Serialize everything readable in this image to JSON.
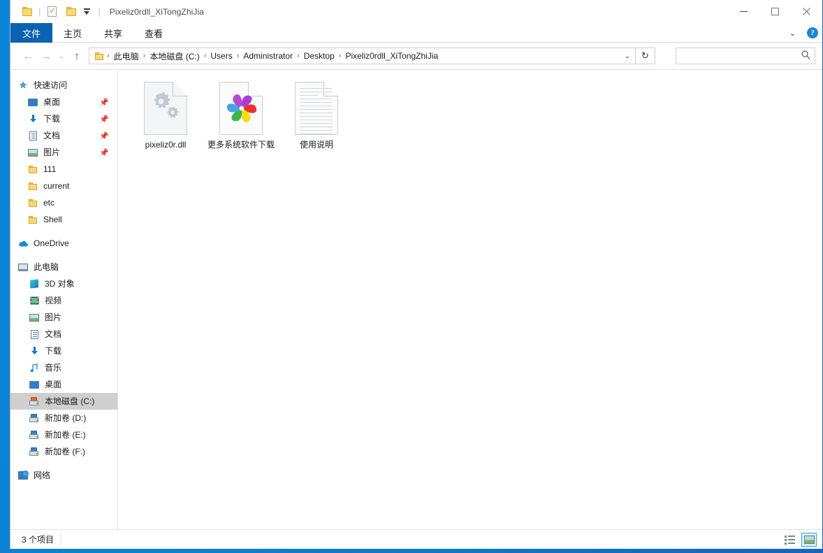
{
  "window": {
    "title": "Pixeliz0rdll_XiTongZhiJia",
    "quick_access_toolbar": [
      {
        "name": "properties-icon",
        "label": "属性"
      },
      {
        "name": "new-folder-icon",
        "label": "新建文件夹"
      },
      {
        "name": "customize-qat-icon",
        "label": "自定义快速访问工具栏"
      }
    ],
    "controls": {
      "minimize": "—",
      "maximize": "☐",
      "close": "✕"
    }
  },
  "ribbon": {
    "tabs": [
      {
        "label": "文件",
        "active": true
      },
      {
        "label": "主页",
        "active": false
      },
      {
        "label": "共享",
        "active": false
      },
      {
        "label": "查看",
        "active": false
      }
    ],
    "collapse_chevron": "⌄",
    "help_label": "?"
  },
  "navigation": {
    "back": "←",
    "forward": "→",
    "recent": "⌄",
    "up": "↑",
    "breadcrumbs": [
      "此电脑",
      "本地磁盘 (C:)",
      "Users",
      "Administrator",
      "Desktop",
      "Pixeliz0rdll_XiTongZhiJia"
    ],
    "breadcrumb_separator": "›",
    "address_dropdown": "⌄",
    "refresh": "↻"
  },
  "search": {
    "value": "",
    "placeholder": "",
    "icon": "search-icon"
  },
  "sidebar": {
    "sections": [
      {
        "header": {
          "label": "快速访问",
          "icon": "star-pin-icon"
        },
        "items": [
          {
            "label": "桌面",
            "icon": "desktop-icon",
            "pinned": true
          },
          {
            "label": "下载",
            "icon": "download-icon",
            "pinned": true
          },
          {
            "label": "文档",
            "icon": "documents-icon",
            "pinned": true
          },
          {
            "label": "图片",
            "icon": "pictures-icon",
            "pinned": true
          },
          {
            "label": "111",
            "icon": "folder-icon",
            "pinned": false
          },
          {
            "label": "current",
            "icon": "folder-icon",
            "pinned": false
          },
          {
            "label": "etc",
            "icon": "folder-icon",
            "pinned": false
          },
          {
            "label": "Shell",
            "icon": "folder-icon",
            "pinned": false
          }
        ]
      },
      {
        "header": {
          "label": "OneDrive",
          "icon": "cloud-icon"
        },
        "items": []
      },
      {
        "header": {
          "label": "此电脑",
          "icon": "computer-icon"
        },
        "items": [
          {
            "label": "3D 对象",
            "icon": "3d-objects-icon",
            "pinned": false
          },
          {
            "label": "视频",
            "icon": "videos-icon",
            "pinned": false
          },
          {
            "label": "图片",
            "icon": "pictures-icon",
            "pinned": false
          },
          {
            "label": "文档",
            "icon": "documents-icon",
            "pinned": false
          },
          {
            "label": "下载",
            "icon": "download-icon",
            "pinned": false
          },
          {
            "label": "音乐",
            "icon": "music-icon",
            "pinned": false
          },
          {
            "label": "桌面",
            "icon": "desktop-icon",
            "pinned": false
          },
          {
            "label": "本地磁盘 (C:)",
            "icon": "windows-drive-icon",
            "pinned": false,
            "selected": true
          },
          {
            "label": "新加卷 (D:)",
            "icon": "drive-icon",
            "pinned": false
          },
          {
            "label": "新加卷 (E:)",
            "icon": "drive-icon",
            "pinned": false
          },
          {
            "label": "新加卷 (F:)",
            "icon": "drive-icon",
            "pinned": false
          }
        ]
      },
      {
        "header": {
          "label": "网络",
          "icon": "network-icon"
        },
        "items": []
      }
    ]
  },
  "files": [
    {
      "name": "pixeliz0r.dll",
      "icon": "dll-gears-icon"
    },
    {
      "name": "更多系统软件下载",
      "icon": "pinwheel-browser-icon"
    },
    {
      "name": "使用说明",
      "icon": "text-document-icon"
    }
  ],
  "status": {
    "item_count": "3 个项目",
    "views": [
      {
        "name": "details-view",
        "active": false
      },
      {
        "name": "large-icons-view",
        "active": true
      }
    ]
  },
  "colors": {
    "accent_blue": "#0b62b0",
    "desktop_blue": "#0b84d9",
    "selected_gray": "#cfcfcf",
    "view_active_border": "#2aa7e0",
    "pinwheel": [
      "#8e3fd8",
      "#e8342c",
      "#f5dd18",
      "#3bb54a",
      "#4aa3e0",
      "#b64ad0"
    ]
  }
}
